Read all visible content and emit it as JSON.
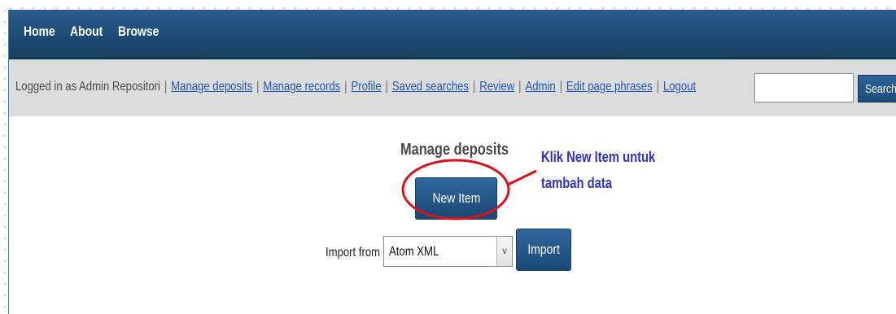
{
  "nav": {
    "items": [
      "Home",
      "About",
      "Browse"
    ]
  },
  "userbar": {
    "logged_in_text": "Logged in as Admin Repositori",
    "links": [
      "Manage deposits",
      "Manage records",
      "Profile",
      "Saved searches",
      "Review",
      "Admin",
      "Edit page phrases",
      "Logout"
    ],
    "search_value": "",
    "search_label": "Search"
  },
  "main": {
    "title": "Manage deposits",
    "new_item_label": "New Item",
    "import_label": "Import from",
    "import_selected": "Atom XML",
    "import_button": "Import"
  },
  "annotation": {
    "line1": "Klik New Item untuk",
    "line2": "tambah data",
    "color": "#2e2edc",
    "ellipse_color": "#e0101a"
  }
}
